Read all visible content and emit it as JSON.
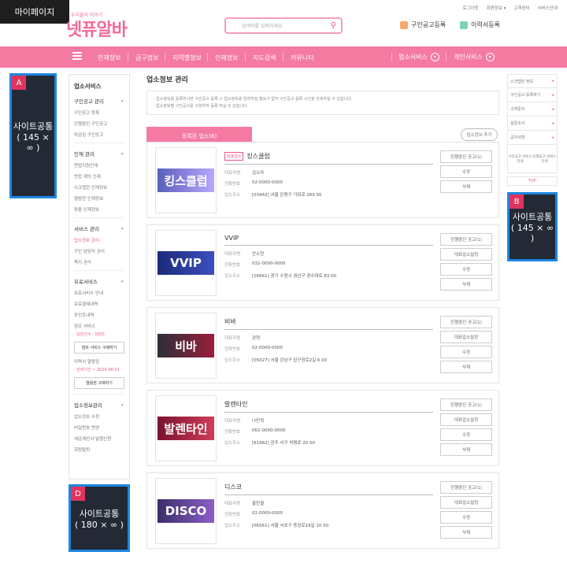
{
  "page_label": "마이페이지",
  "logo": {
    "sub": "우리들의 이야기",
    "main": "넷퓨알바"
  },
  "search": {
    "placeholder": "검색어를 입력하세요"
  },
  "top_links": [
    "로그아웃",
    "회원정보 ▾",
    "고객센터",
    "서비스안내"
  ],
  "header_buttons": {
    "job_post": "구인공고등록",
    "resume": "이력서등록"
  },
  "nav": {
    "items": [
      "인재정보",
      "급구정보",
      "지역별정보",
      "인재정보",
      "지도검색",
      "커뮤니티"
    ],
    "business": "업소서비스",
    "personal": "개인서비스"
  },
  "ads": {
    "a": {
      "tag": "A",
      "t1": "사이트공통",
      "t2": "( 145 × ∞ )"
    },
    "b": {
      "tag": "B",
      "t1": "사이트공통",
      "t2": "( 145 × ∞ )"
    },
    "d": {
      "tag": "D",
      "t1": "사이트공통",
      "t2": "( 180 × ∞ )"
    }
  },
  "left_nav": {
    "title": "업소서비스",
    "sec1": {
      "title": "구인공고 관리",
      "items": [
        "구인공고 등록",
        "진행중인 구인공고",
        "마감된 구인공고"
      ]
    },
    "sec2": {
      "title": "인재 관리",
      "items": [
        "면접지원인재",
        "면접 제의 인재",
        "스크랩한 인재정보",
        "열람한 인재정보",
        "맞춤 인재정보"
      ]
    },
    "sec3": {
      "title": "서비스 관리",
      "items": [
        "업소정보 관리",
        "구인 담당자 관리",
        "쪽지 관리"
      ]
    },
    "sec4": {
      "title": "유료서비스",
      "items": [
        "유료서비스 안내",
        "유료결제내역",
        "포인트내역"
      ],
      "jump_label": "점프 서비스",
      "jump_remain": "· 남은건수 : 0회건",
      "jump_btn": "점프 서비스 구매하기",
      "read_label": "이력서 열람권",
      "read_remain": "· 잔여기간 ~ 2020-08-01",
      "read_btn": "열람권 구매하기"
    },
    "sec5": {
      "title": "업소정보관리",
      "items": [
        "업소정보 수정",
        "비밀번호 변경",
        "세금계산서 발행신청",
        "회원탈퇴"
      ]
    }
  },
  "main": {
    "title": "업소정보 관리",
    "notice": [
      "· 업소정보를 등록하시면 구인공고 등록 시 업소정보를 입력하실 필요가 없어 구인공고 등록 시간을 단축하실 수 있습니다.",
      "· 업소정보별 구인공고를 구분하여 등록 하실 수 있습니다."
    ],
    "tab": "등록된 업소(6)",
    "add_btn": "업소정보 추가",
    "labels": {
      "rep": "대표자명",
      "phone": "전화번호",
      "addr": "업소주소",
      "badge": "대표업소"
    },
    "btn_labels": {
      "ongoing": "진행중인 공고(1)",
      "set_rep": "대표업소설정",
      "edit": "수정",
      "del": "삭제"
    },
    "cards": [
      {
        "banner": "킹스클럽",
        "name": "킹스클럽",
        "rep": "김소라",
        "phone": "02-0000-0000",
        "addr": "[03442] 서울 은평구 가좌로 269 00"
      },
      {
        "banner": "VVIP",
        "name": "VVIP",
        "rep": "안소현",
        "phone": "032-0000-0000",
        "addr": "[16661] 경기 수원시 권선구 경수대로 83 00"
      },
      {
        "banner": "비바",
        "name": "비바",
        "rep": "강혁",
        "phone": "02-0000-0000",
        "addr": "[05027] 서울 강남구 압구정로2길 6 00"
      },
      {
        "banner": "발렌타인",
        "name": "발렌타인",
        "rep": "나민혁",
        "phone": "062-0000-0000",
        "addr": "[61962] 광주 서구 치평로 20 00"
      },
      {
        "banner": "DISCO",
        "name": "디스코",
        "rep": "홍민결",
        "phone": "02-0000-0000",
        "addr": "[06561] 서울 서초구 동광로19길 10 00"
      }
    ]
  },
  "right": {
    "items": [
      "스크랩한 정보",
      "구인공고 등록하기",
      "고객문의",
      "설문조사",
      "공지사항"
    ],
    "icon1": "구인공고 서비스안내",
    "icon2": "인재공고 서비스안내",
    "top": "TOP"
  }
}
